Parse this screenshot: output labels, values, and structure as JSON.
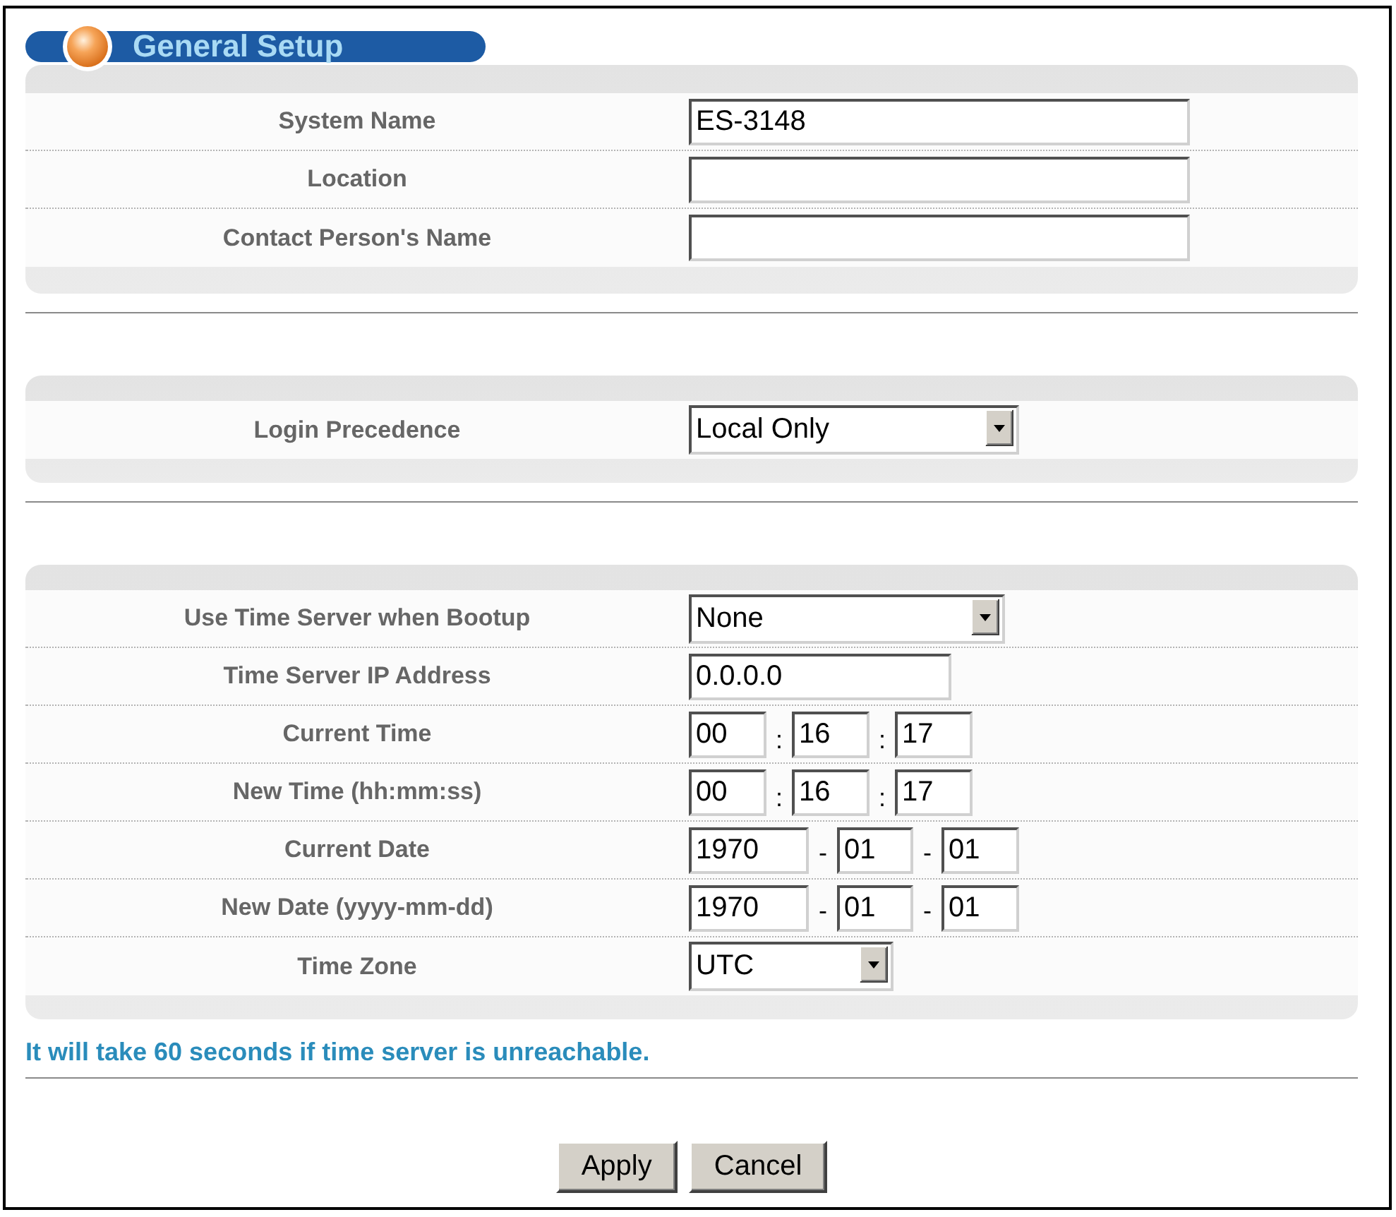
{
  "title": "General Setup",
  "sections": [
    {
      "rows": [
        {
          "label": "System Name",
          "kind": "text",
          "value": "ES-3148"
        },
        {
          "label": "Location",
          "kind": "text"
        },
        {
          "label": "Contact Person's Name",
          "kind": "text"
        }
      ]
    },
    {
      "rows": [
        {
          "label": "Login Precedence",
          "kind": "select",
          "value": "Local Only"
        }
      ]
    },
    {
      "rows": [
        {
          "label": "Use Time Server when Bootup",
          "kind": "select",
          "value": "None"
        },
        {
          "label": "Time Server IP Address",
          "kind": "text",
          "value": "0.0.0.0"
        },
        {
          "label": "Current Time",
          "kind": "time",
          "parts": [
            "00",
            "16",
            "17"
          ],
          "separators": [
            ":",
            ":"
          ]
        },
        {
          "label": "New Time (hh:mm:ss)",
          "kind": "time",
          "parts": [
            "00",
            "16",
            "17"
          ],
          "separators": [
            ":",
            ":"
          ]
        },
        {
          "label": "Current Date",
          "kind": "date",
          "parts": [
            "1970",
            "01",
            "01"
          ],
          "separators": [
            "-",
            "-"
          ]
        },
        {
          "label": "New Date (yyyy-mm-dd)",
          "kind": "date",
          "parts": [
            "1970",
            "01",
            "01"
          ],
          "separators": [
            "-",
            "-"
          ]
        },
        {
          "label": "Time Zone",
          "kind": "select",
          "value": "UTC"
        }
      ],
      "note": "It will take 60 seconds if time server is unreachable."
    }
  ],
  "buttons": [
    "Apply",
    "Cancel"
  ]
}
